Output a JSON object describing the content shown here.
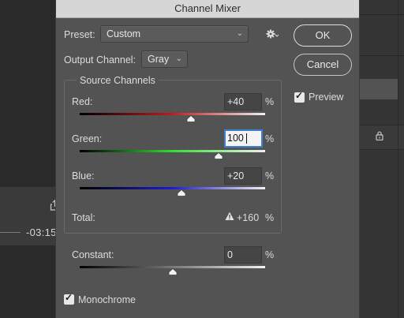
{
  "dialog": {
    "title": "Channel Mixer",
    "preset_label": "Preset:",
    "preset_value": "Custom",
    "output_label": "Output Channel:",
    "output_value": "Gray",
    "ok_label": "OK",
    "cancel_label": "Cancel",
    "preview_label": "Preview",
    "preview_checked": true,
    "source_title": "Source Channels",
    "channels": [
      {
        "label": "Red:",
        "value": "+40",
        "percent": "%",
        "slider_fraction": 0.6,
        "gradient": [
          "#000000",
          "#c01c1c",
          "#f0f0f0"
        ]
      },
      {
        "label": "Green:",
        "value": "100",
        "percent": "%",
        "slider_fraction": 0.75,
        "gradient": [
          "#000000",
          "#2fe02f",
          "#f0f0f0"
        ]
      },
      {
        "label": "Blue:",
        "value": "+20",
        "percent": "%",
        "slider_fraction": 0.55,
        "gradient": [
          "#000000",
          "#1c1cd0",
          "#f0f0f0"
        ]
      }
    ],
    "total_label": "Total:",
    "total_value": "+160",
    "total_percent": "%",
    "constant_label": "Constant:",
    "constant_value": "0",
    "constant_percent": "%",
    "constant_slider_fraction": 0.5,
    "monochrome_label": "Monochrome",
    "monochrome_checked": true
  },
  "background": {
    "time_text": "-03:15"
  },
  "colors": {
    "dialog_bg": "#535353",
    "focus_ring": "#3f7fd6"
  }
}
